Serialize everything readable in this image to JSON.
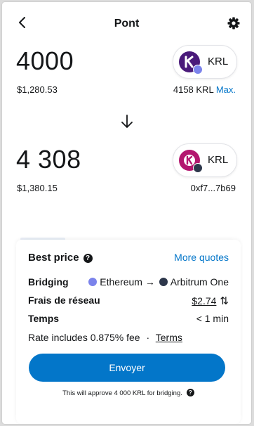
{
  "header": {
    "title": "Pont"
  },
  "source": {
    "amount": "4000",
    "fiat": "$1,280.53",
    "token": "KRL",
    "balance": "4158 KRL",
    "max_label": "Max."
  },
  "destination": {
    "amount": "4 308",
    "fiat": "$1,380.15",
    "token": "KRL",
    "address": "0xf7...7b69"
  },
  "quote": {
    "best_price_label": "Best price",
    "more_quotes_label": "More quotes",
    "bridging_label": "Bridging",
    "from_chain": "Ethereum",
    "arrow": "→",
    "to_chain": "Arbitrum One",
    "fees_label": "Frais de réseau",
    "fees_value": "$2.74",
    "time_label": "Temps",
    "time_value": "< 1 min",
    "rate_text": "Rate includes 0.875% fee",
    "separator": "·",
    "terms_label": "Terms"
  },
  "submit": {
    "label": "Envoyer"
  },
  "approval_note": "This will approve 4 000 KRL for bridging.",
  "colors": {
    "accent": "#0376c9",
    "krl_purple": "#4a1a7a",
    "krl_pink": "#b3176f",
    "ethereum": "#7b83eb",
    "arbitrum": "#2d374b"
  },
  "icons": {
    "back": "chevron-left-icon",
    "settings": "gear-icon",
    "direction": "arrow-down-icon",
    "info": "question-icon",
    "swap_fee": "swap-vertical-icon"
  }
}
